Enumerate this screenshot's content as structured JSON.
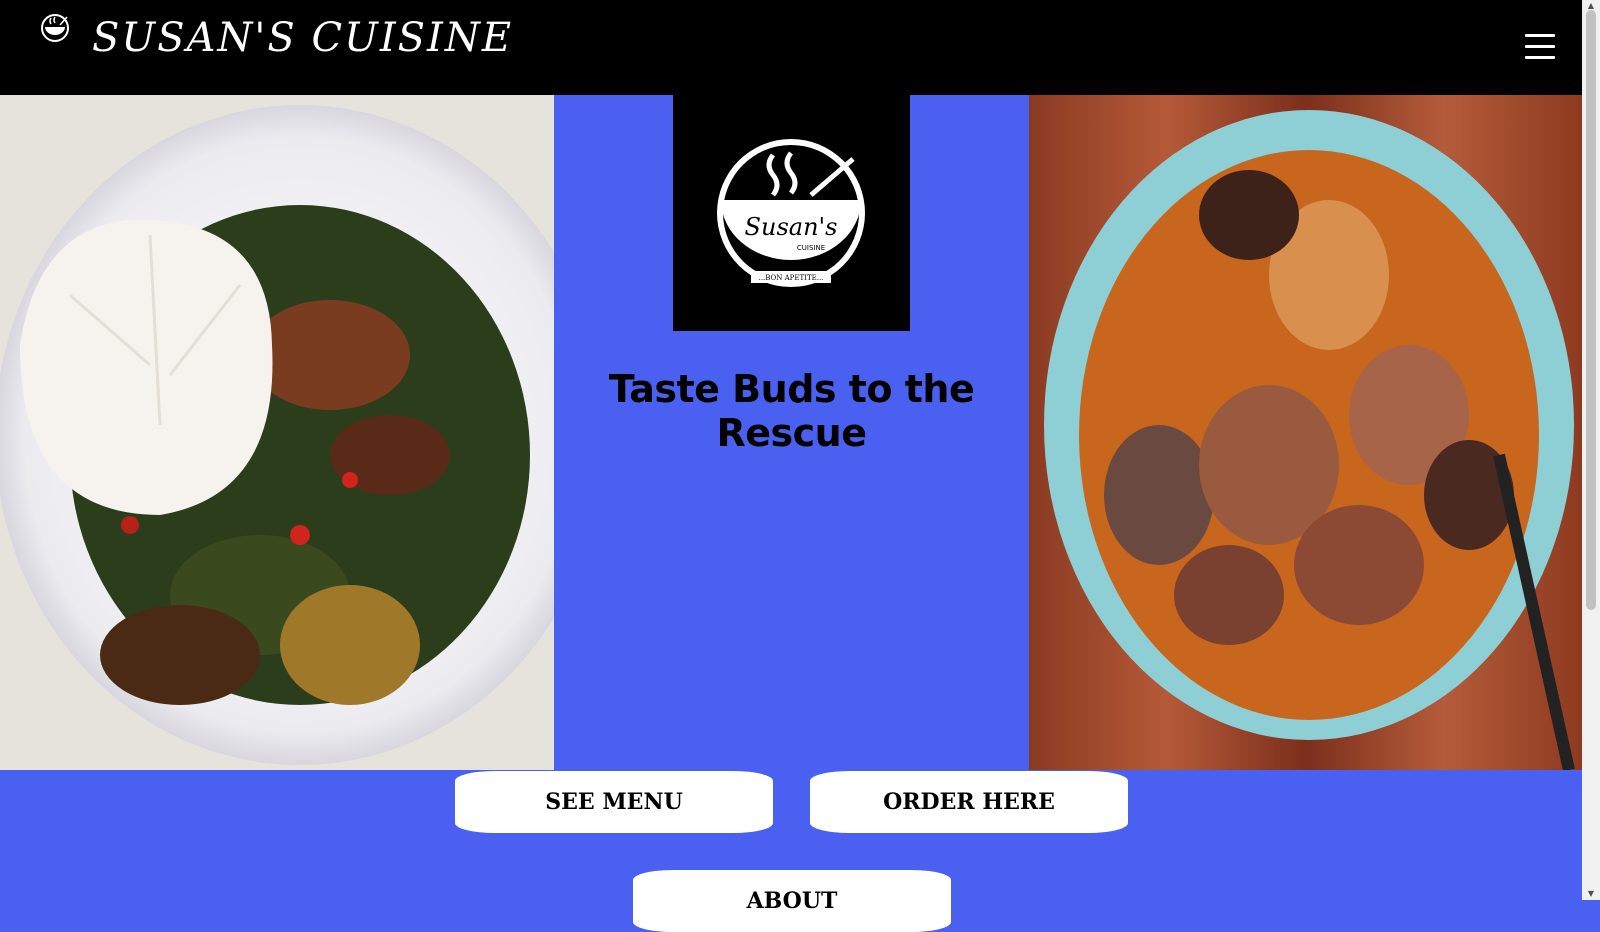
{
  "header": {
    "title": "SUSAN'S CUISINE"
  },
  "hero": {
    "logo": {
      "script": "Susan's",
      "sub": "CUISINE",
      "motto": "...BON APETITE..."
    },
    "tagline": "Taste Buds to the Rescue"
  },
  "buttons": {
    "menu": "See Menu",
    "order": "Order Here",
    "about": "About"
  },
  "colors": {
    "background": "#4a60f0",
    "header": "#000000"
  }
}
